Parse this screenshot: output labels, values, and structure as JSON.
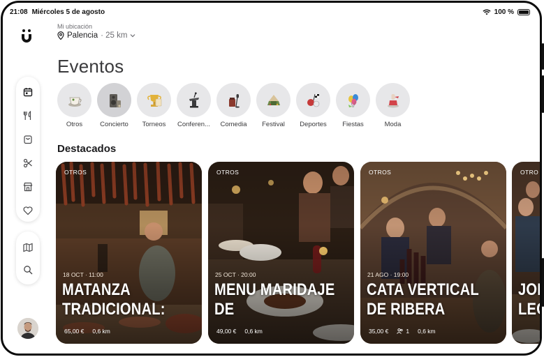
{
  "status_bar": {
    "time": "21:08",
    "date": "Miércoles 5 de agosto",
    "battery": "100 %"
  },
  "location": {
    "label": "Mi ubicación",
    "city": "Palencia",
    "radius": "· 25 km"
  },
  "page_title": "Eventos",
  "categories": [
    {
      "label": "Otros",
      "icon": "cup-icon"
    },
    {
      "label": "Concierto",
      "icon": "speaker-icon",
      "selected": true
    },
    {
      "label": "Torneos",
      "icon": "trophy-icon"
    },
    {
      "label": "Conferen...",
      "icon": "podium-icon"
    },
    {
      "label": "Comedia",
      "icon": "microphone-icon"
    },
    {
      "label": "Festival",
      "icon": "stage-icon"
    },
    {
      "label": "Deportes",
      "icon": "racing-flags-icon"
    },
    {
      "label": "Fiestas",
      "icon": "balloons-icon"
    },
    {
      "label": "Moda",
      "icon": "fashion-icon"
    }
  ],
  "featured_title": "Destacados",
  "events": [
    {
      "tag": "OTROS",
      "meta": "18 OCT · 11:00",
      "title_line1": "MATANZA",
      "title_line2": "TRADICIONAL:",
      "price": "65,00 €",
      "distance": "0,6 km",
      "attendees": ""
    },
    {
      "tag": "OTROS",
      "meta": "25 OCT · 20:00",
      "title_line1": "MENU MARIDAJE",
      "title_line2": "DE",
      "price": "49,00 €",
      "distance": "0,6 km",
      "attendees": ""
    },
    {
      "tag": "OTROS",
      "meta": "21 AGO · 19:00",
      "title_line1": "CATA VERTICAL",
      "title_line2": "DE RIBERA",
      "price": "35,00 €",
      "distance": "0,6 km",
      "attendees": "1"
    },
    {
      "tag": "OTRO",
      "meta": "",
      "title_line1": "JOI",
      "title_line2": "LEC",
      "price": "",
      "distance": "",
      "attendees": ""
    }
  ],
  "colors": {
    "accent": "#1c1c1e",
    "chip_bg": "#e7e7e9",
    "muted_text": "#6e6e73"
  }
}
